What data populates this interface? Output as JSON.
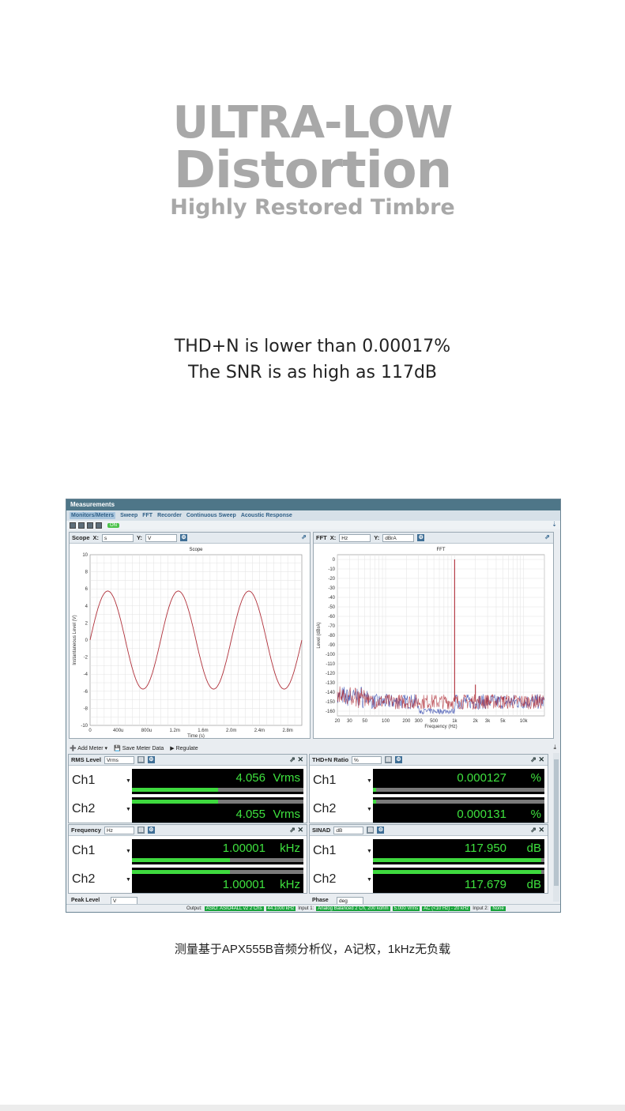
{
  "headline": {
    "line1": "ULTRA-LOW",
    "line2": "Distortion",
    "line3": "Highly Restored Timbre"
  },
  "specs": {
    "thdn": "THD+N is lower than 0.00017%",
    "snr": "The SNR is as high as 117dB"
  },
  "caption": "测量基于APX555B音频分析仪，A记权，1kHz无负载",
  "app": {
    "title": "Measurements",
    "tabs": [
      "Monitors/Meters",
      "Sweep",
      "FFT",
      "Recorder",
      "Continuous Sweep",
      "Acoustic Response"
    ],
    "toolbar_toggle": "ON",
    "scope": {
      "label": "Scope",
      "x_label": "X:",
      "x_unit": "s",
      "y_label": "Y:",
      "y_unit": "V",
      "chart_title": "Scope",
      "xlabel": "Time (s)",
      "ylabel": "Instantaneous Level (V)"
    },
    "fft": {
      "label": "FFT",
      "x_label": "X:",
      "x_unit": "Hz",
      "y_label": "Y:",
      "y_unit": "dBrA",
      "chart_title": "FFT",
      "xlabel": "Frequency (Hz)",
      "ylabel": "Level (dBrA)"
    },
    "meter_toolbar": {
      "add": "Add Meter",
      "save": "Save Meter Data",
      "regulate": "Regulate"
    },
    "meters": [
      {
        "name": "RMS Level",
        "unit_sel": "Vrms",
        "unit": "Vrms",
        "channels": [
          {
            "ch": "Ch1",
            "value": "4.056",
            "fill": 0.5
          },
          {
            "ch": "Ch2",
            "value": "4.055",
            "fill": 0.5
          }
        ]
      },
      {
        "name": "THD+N Ratio",
        "unit_sel": "%",
        "unit": "%",
        "channels": [
          {
            "ch": "Ch1",
            "value": "0.000127",
            "fill": 0.02
          },
          {
            "ch": "Ch2",
            "value": "0.000131",
            "fill": 0.02
          }
        ]
      },
      {
        "name": "Frequency",
        "unit_sel": "Hz",
        "unit": "kHz",
        "channels": [
          {
            "ch": "Ch1",
            "value": "1.00001",
            "fill": 0.57
          },
          {
            "ch": "Ch2",
            "value": "1.00001",
            "fill": 0.57
          }
        ]
      },
      {
        "name": "SINAD",
        "unit_sel": "dB",
        "unit": "dB",
        "channels": [
          {
            "ch": "Ch1",
            "value": "117.950",
            "fill": 0.98
          },
          {
            "ch": "Ch2",
            "value": "117.679",
            "fill": 0.98
          }
        ]
      }
    ],
    "peak": {
      "name": "Peak Level",
      "unit_sel": "V"
    },
    "phase": {
      "name": "Phase",
      "unit_sel": "deg"
    },
    "status": {
      "output_label": "Output:",
      "output_value": "ASIO: ASIO4ALL v2 2 Chs",
      "output_rate": "44.1000 kHz",
      "input1_label": "Input 1:",
      "input1_value": "Analog Balanced 2 Ch, 200 kohm",
      "input1_level": "5.000 Vrms",
      "input1_filter": "AC (<10 Hz) - 20 kHz",
      "input2_label": "Input 2:",
      "input2_value": "None"
    }
  },
  "chart_data": [
    {
      "type": "line",
      "title": "Scope",
      "xlabel": "Time (s)",
      "ylabel": "Instantaneous Level (V)",
      "x_ticks": [
        "0",
        "400u",
        "800u",
        "1.2m",
        "1.6m",
        "2.0m",
        "2.4m",
        "2.8m"
      ],
      "xlim": [
        0,
        0.003
      ],
      "ylim": [
        -10,
        10
      ],
      "y_ticks": [
        10,
        8,
        6,
        4,
        2,
        0,
        -2,
        -4,
        -6,
        -8,
        -10
      ],
      "series": [
        {
          "amplitude": 5.74,
          "frequency_hz": 1000,
          "color": "#b0303a"
        }
      ]
    },
    {
      "type": "line",
      "title": "FFT",
      "xlabel": "Frequency (Hz)",
      "ylabel": "Level (dBrA)",
      "x_scale": "log",
      "x_ticks": [
        "20",
        "30",
        "50",
        "100",
        "200",
        "300",
        "500",
        "1k",
        "2k",
        "3k",
        "5k",
        "10k"
      ],
      "x_tick_values": [
        20,
        30,
        50,
        100,
        200,
        300,
        500,
        1000,
        2000,
        3000,
        5000,
        10000
      ],
      "xlim": [
        20,
        20000
      ],
      "ylim": [
        -165,
        5
      ],
      "y_ticks": [
        0,
        -10,
        -20,
        -30,
        -40,
        -50,
        -60,
        -70,
        -80,
        -90,
        -100,
        -110,
        -120,
        -130,
        -140,
        -150,
        -160
      ],
      "peaks": [
        {
          "x": 1000,
          "y": 0
        },
        {
          "x": 2000,
          "y": -132
        },
        {
          "x": 3000,
          "y": -143
        },
        {
          "x": 5000,
          "y": -145
        }
      ],
      "noise_floor": -150,
      "colors": [
        "#b0303a",
        "#3b4fb0"
      ]
    }
  ]
}
